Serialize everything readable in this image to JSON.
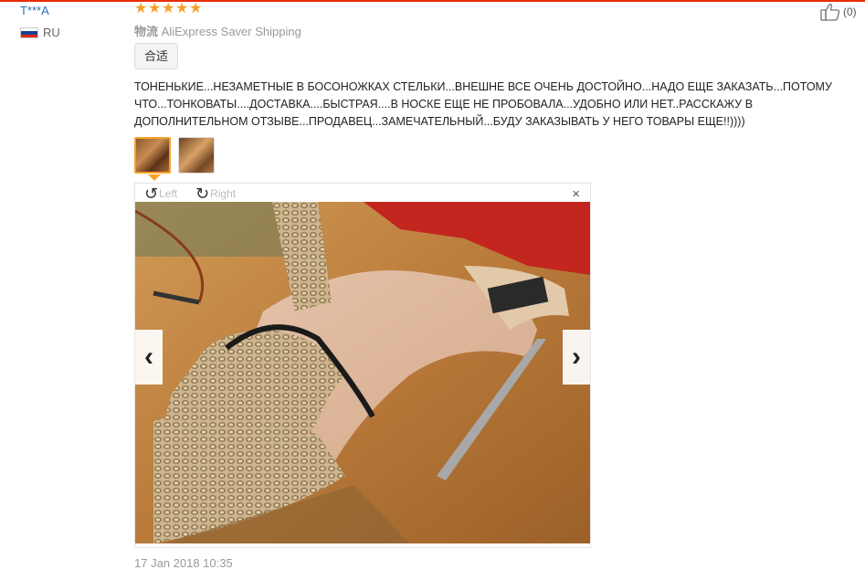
{
  "reviewer": {
    "name": "T***A",
    "country_code": "RU"
  },
  "rating": {
    "stars": 5,
    "max": 5,
    "color": "#f7a128"
  },
  "shipping": {
    "label": "物流",
    "value": "AliExpress Saver Shipping"
  },
  "fit_button": "合适",
  "feedback": "ТОНЕНЬКИЕ...НЕЗАМЕТНЫЕ В БОСОНОЖКАХ СТЕЛЬКИ...ВНЕШНЕ ВСЕ ОЧЕНЬ ДОСТОЙНО...НАДО ЕЩЕ ЗАКАЗАТЬ...ПОТОМУ ЧТО...ТОНКОВАТЫ....ДОСТАВКА....БЫСТРАЯ....В НОСКЕ ЕЩЕ НЕ ПРОБОВАЛА...УДОБНО ИЛИ НЕТ..РАССКАЖУ В ДОПОЛНИТЕЛЬНОМ ОТЗЫВЕ...ПРОДАВЕЦ...ЗАМЕЧАТЕЛЬНЫЙ...БУДУ ЗАКАЗЫВАТЬ У НЕГО ТОВАРЫ ЕЩЕ!!))))",
  "viewer": {
    "rotate_left": "Left",
    "rotate_right": "Right",
    "close": "×",
    "prev": "‹",
    "next": "›"
  },
  "date": "17 Jan 2018 10:35",
  "helpful_count": "(0)",
  "colors": {
    "accent": "#e62e04",
    "link": "#2d6db5"
  }
}
